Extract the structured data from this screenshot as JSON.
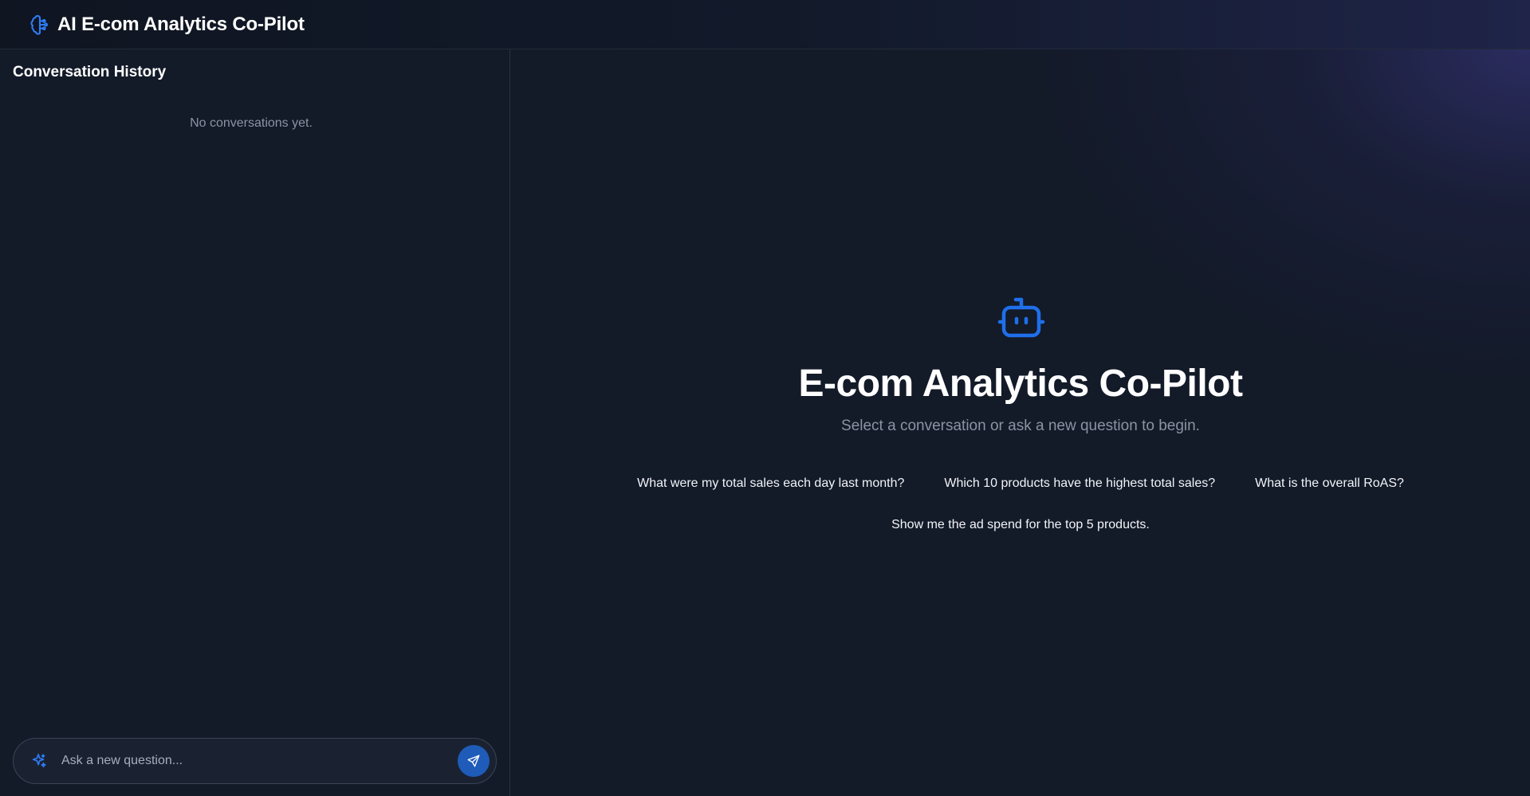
{
  "header": {
    "title": "AI E-com Analytics Co-Pilot",
    "logo_icon": "brain-icon"
  },
  "sidebar": {
    "title": "Conversation History",
    "empty_text": "No conversations yet.",
    "input": {
      "placeholder": "Ask a new question...",
      "value": "",
      "leading_icon": "sparkle-icon",
      "send_icon": "send-icon"
    }
  },
  "main": {
    "icon": "robot-icon",
    "title": "E-com Analytics Co-Pilot",
    "subtitle": "Select a conversation or ask a new question to begin.",
    "suggestions": [
      "What were my total sales each day last month?",
      "Which 10 products have the highest total sales?",
      "What is the overall RoAS?",
      "Show me the ad spend for the top 5 products."
    ]
  },
  "colors": {
    "accent": "#1f6feb",
    "send_button": "#1f5bb8",
    "background": "#131a28",
    "muted_text": "#8b94a4"
  }
}
